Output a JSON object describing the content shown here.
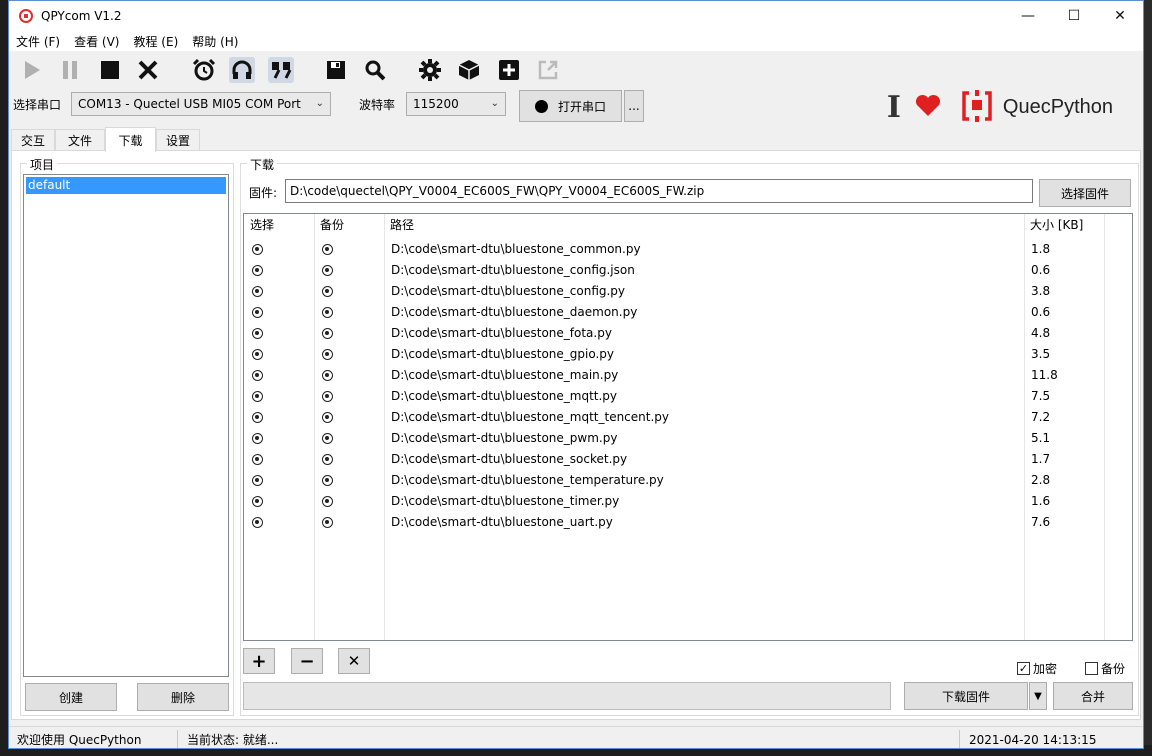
{
  "window": {
    "title": "QPYcom V1.2",
    "minimize": "—",
    "maximize": "☐",
    "close": "✕"
  },
  "menu": [
    "文件 (F)",
    "查看 (V)",
    "教程 (E)",
    "帮助 (H)"
  ],
  "toolbar_icons": [
    "play-icon",
    "pause-icon",
    "stop-icon",
    "close-icon",
    "alarm-clock-icon",
    "headset-icon",
    "quote-icon",
    "save-icon",
    "search-icon",
    "gear-icon",
    "box-icon",
    "add-icon",
    "export-icon"
  ],
  "port": {
    "port_label": "选择串口",
    "port_value": "COM13 - Quectel USB MI05 COM Port",
    "baud_label": "波特率",
    "baud_value": "115200",
    "open_button": "打开串口",
    "more_button": "..."
  },
  "brand": {
    "name": "QuecPython",
    "accent": "#e02020"
  },
  "tabs": [
    "交互",
    "文件",
    "下载",
    "设置"
  ],
  "active_tab": "下载",
  "project": {
    "title": "项目",
    "items": [
      "default"
    ],
    "create_button": "创建",
    "delete_button": "删除"
  },
  "download": {
    "title": "下载",
    "firmware_label": "固件:",
    "firmware_path": "D:\\code\\quectel\\QPY_V0004_EC600S_FW\\QPY_V0004_EC600S_FW.zip",
    "select_firmware_button": "选择固件",
    "columns": [
      "选择",
      "备份",
      "路径",
      "大小 [KB]"
    ],
    "rows": [
      {
        "path": "D:\\code\\smart-dtu\\bluestone_common.py",
        "size": "1.8"
      },
      {
        "path": "D:\\code\\smart-dtu\\bluestone_config.json",
        "size": "0.6"
      },
      {
        "path": "D:\\code\\smart-dtu\\bluestone_config.py",
        "size": "3.8"
      },
      {
        "path": "D:\\code\\smart-dtu\\bluestone_daemon.py",
        "size": "0.6"
      },
      {
        "path": "D:\\code\\smart-dtu\\bluestone_fota.py",
        "size": "4.8"
      },
      {
        "path": "D:\\code\\smart-dtu\\bluestone_gpio.py",
        "size": "3.5"
      },
      {
        "path": "D:\\code\\smart-dtu\\bluestone_main.py",
        "size": "11.8"
      },
      {
        "path": "D:\\code\\smart-dtu\\bluestone_mqtt.py",
        "size": "7.5"
      },
      {
        "path": "D:\\code\\smart-dtu\\bluestone_mqtt_tencent.py",
        "size": "7.2"
      },
      {
        "path": "D:\\code\\smart-dtu\\bluestone_pwm.py",
        "size": "5.1"
      },
      {
        "path": "D:\\code\\smart-dtu\\bluestone_socket.py",
        "size": "1.7"
      },
      {
        "path": "D:\\code\\smart-dtu\\bluestone_temperature.py",
        "size": "2.8"
      },
      {
        "path": "D:\\code\\smart-dtu\\bluestone_timer.py",
        "size": "1.6"
      },
      {
        "path": "D:\\code\\smart-dtu\\bluestone_uart.py",
        "size": "7.6"
      }
    ],
    "add_button": "+",
    "remove_button": "−",
    "clear_button": "✕",
    "encrypt_label": "加密",
    "encrypt_checked": true,
    "backup_label": "备份",
    "backup_checked": false,
    "download_firmware_button": "下载固件",
    "merge_button": "合并",
    "progress": 0
  },
  "status": {
    "welcome": "欢迎使用 QuecPython",
    "state": "当前状态: 就绪...",
    "datetime": "2021-04-20 14:13:15"
  }
}
